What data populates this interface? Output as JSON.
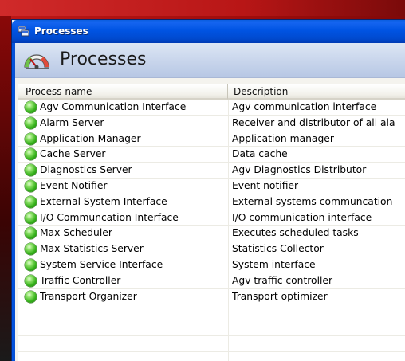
{
  "window": {
    "title": "Processes",
    "header_title": "Processes"
  },
  "icons": {
    "window": "window-app-icon",
    "header": "gauge-icon",
    "status": "status-running-icon"
  },
  "colors": {
    "titlebar": "#0054e3",
    "header_band": "#c9d6ec",
    "status_green": "#37b21c",
    "desktop": "#b81616"
  },
  "table": {
    "columns": [
      "Process name",
      "Description"
    ],
    "rows": [
      {
        "name": "Agv Communication Interface",
        "description": "Agv communication interface"
      },
      {
        "name": "Alarm Server",
        "description": "Receiver and distributor of all ala"
      },
      {
        "name": "Application Manager",
        "description": "Application manager"
      },
      {
        "name": "Cache Server",
        "description": "Data cache"
      },
      {
        "name": "Diagnostics Server",
        "description": "Agv Diagnostics Distributor"
      },
      {
        "name": "Event Notifier",
        "description": "Event notifier"
      },
      {
        "name": "External System Interface",
        "description": "External systems communcation"
      },
      {
        "name": "I/O Communcation Interface",
        "description": "I/O communication interface"
      },
      {
        "name": "Max Scheduler",
        "description": "Executes scheduled tasks"
      },
      {
        "name": "Max Statistics Server",
        "description": "Statistics Collector"
      },
      {
        "name": "System Service Interface",
        "description": "System interface"
      },
      {
        "name": "Traffic Controller",
        "description": "Agv traffic controller"
      },
      {
        "name": "Transport Organizer",
        "description": "Transport optimizer"
      }
    ]
  }
}
